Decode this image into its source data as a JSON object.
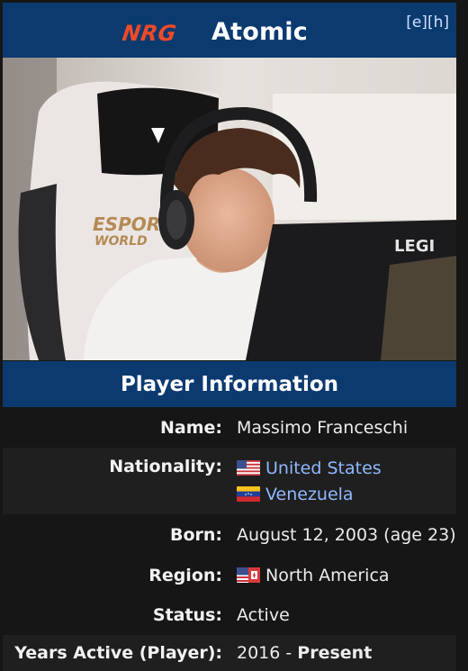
{
  "header": {
    "team_logo_text": "NRG",
    "player_name": "Atomic",
    "edit_link": "[e]",
    "history_link": "[h]"
  },
  "photo": {
    "description_icon": "player-photo"
  },
  "section": {
    "title": "Player Information"
  },
  "fields": {
    "name": {
      "label": "Name:",
      "value": "Massimo Franceschi"
    },
    "nationality": {
      "label": "Nationality:",
      "values": [
        {
          "flag": "flag-us-icon",
          "text": "United States"
        },
        {
          "flag": "flag-ve-icon",
          "text": "Venezuela"
        }
      ]
    },
    "born": {
      "label": "Born:",
      "value": "August 12, 2003 (age 23)"
    },
    "region": {
      "label": "Region:",
      "flag": "flag-na-icon",
      "value": "North America"
    },
    "status": {
      "label": "Status:",
      "value": "Active"
    },
    "years_active": {
      "label": "Years Active (Player):",
      "start": "2016 - ",
      "end": "Present"
    }
  },
  "colors": {
    "header_bg": "#0b3a6f",
    "body_bg": "#161616",
    "alt_row_bg": "#1f1f1f",
    "link": "#8fb8ff",
    "logo": "#f04a2a"
  }
}
